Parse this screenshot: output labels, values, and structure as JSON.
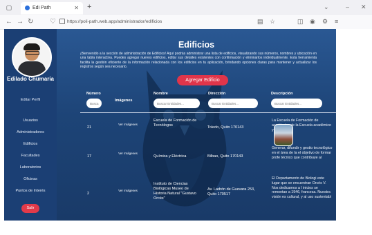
{
  "browser": {
    "tab_title": "Edi Path",
    "url": "https://poli-path.web.app/administrador/edificios"
  },
  "sidebar": {
    "username": "Edilado Chumaria",
    "profile_link": "Editar Perfil",
    "items": [
      {
        "label": "Usuarios"
      },
      {
        "label": "Administradores"
      },
      {
        "label": "Edificios"
      },
      {
        "label": "Facultades"
      },
      {
        "label": "Laboratorios"
      },
      {
        "label": "Oficinas"
      },
      {
        "label": "Puntos de Interés"
      }
    ],
    "logout_label": "Salir"
  },
  "main": {
    "title": "Edificios",
    "description": "¡Bienvenido a la sección de administración de Edificios! Aquí podrás administrar una lista de edificios, visualizando sus números, nombres y ubicación en una tabla interactiva. Puedes agregar nuevos edificios, editar sus detalles existentes con confirmación y eliminarlos individualmente. Esta herramienta facilita la gestión eficiente de la información relacionada con los edificios en tu aplicación, brindando opciones claras para mantener y actualizar los registros según sea necesario.",
    "add_button": "Agregar Edificio"
  },
  "table": {
    "headers": {
      "numero": "Número",
      "imagenes": "Imágenes",
      "nombre": "Nombre",
      "direccion": "Dirección",
      "descripcion": "Descripción"
    },
    "filter_placeholder_short": "Busca",
    "filter_placeholder": "Buscar Entidades...",
    "rows": [
      {
        "numero": "21",
        "imagen": "Ver Imágenes",
        "nombre": "Escuela de Formación de Tecnólogos",
        "direccion": "Toledo, Quito 170143",
        "descripcion": "La Escuela de Formación de académica de la Escuela académico y administra"
      },
      {
        "numero": "17",
        "imagen": "Ver Imágenes",
        "nombre": "Química y Eléctrica",
        "direccion": "Bilbao, Quito 170143",
        "descripcion": "Generar, difundir y gestio tecnológico en el área de la el objetivo de formar profe técnico que contribuye al"
      },
      {
        "numero": "2",
        "imagen": "Ver Imágenes",
        "nombre": "Instituto de Ciencias Biológicas Museo de Historia Natural \"Gustavo Orcés\"",
        "direccion": "Av. Ladrón de Guevara 253, Quito 170517",
        "descripcion": "El Departamento de Biologi este lugar que se encuentran Orcés V. Nos dedicamos a l inicios se remontan a 1946, francesa. Nuestra visión es cultural, y al uso sustentabl"
      }
    ]
  },
  "colors": {
    "sidebar": "#1b3f74",
    "main": "#1d4477",
    "accent": "#e0354a"
  }
}
